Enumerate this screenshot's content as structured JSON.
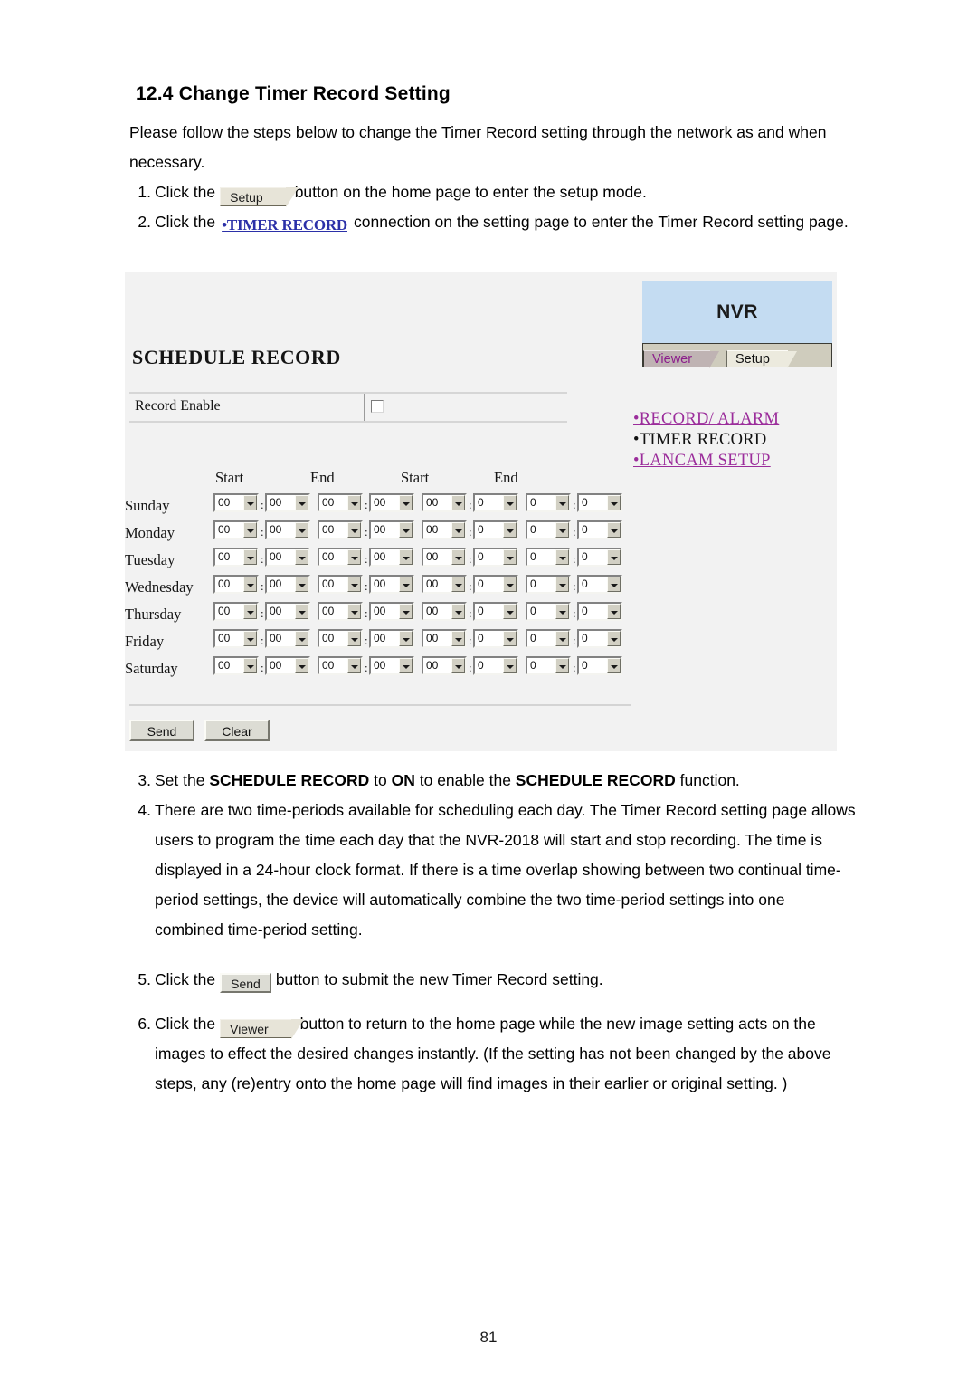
{
  "document": {
    "heading": "12.4 Change Timer Record Setting",
    "intro": "Please follow the steps below to change the Timer Record setting through the network as and when necessary.",
    "page_number": "81"
  },
  "steps_top": [
    {
      "num": "1.",
      "before": "Click the",
      "button": "Setup",
      "button_kind": "tab",
      "after": "button on the home page to enter the setup mode."
    },
    {
      "num": "2.",
      "before": "Click the",
      "link": "•TIMER RECORD",
      "after": "connection on the setting page to enter the Timer Record setting page."
    }
  ],
  "steps_bottom": [
    {
      "num": "3.",
      "segments": [
        {
          "text": "Set the ",
          "bold": false
        },
        {
          "text": "SCHEDULE RECORD",
          "bold": true
        },
        {
          "text": " to ",
          "bold": false
        },
        {
          "text": "ON",
          "bold": true
        },
        {
          "text": " to enable the ",
          "bold": false
        },
        {
          "text": "SCHEDULE RECORD",
          "bold": true
        },
        {
          "text": " function.",
          "bold": false
        }
      ]
    },
    {
      "num": "4.",
      "segments": [
        {
          "text": "There are two time-periods available for scheduling each day. The Timer Record setting page allows users to program the time each day that the NVR-2018 will start and stop recording. The time is displayed in a 24-hour clock format. If there is a time overlap showing between two continual time-period settings, the device will automatically combine the two time-period settings into one combined time-period setting.",
          "bold": false
        }
      ]
    },
    {
      "num": "5.",
      "before": "Click the",
      "button": "Send",
      "button_kind": "push",
      "after": "button to submit the new Timer Record setting."
    },
    {
      "num": "6.",
      "before": "Click the",
      "button": "Viewer",
      "button_kind": "tab",
      "after": "button to return to the home page while the new image setting acts on the       images to effect the desired changes instantly. (If the setting has not been changed by the above steps, any (re)entry onto the home page will find images in their earlier or original setting. )"
    }
  ],
  "screenshot": {
    "title": "SCHEDULE RECORD",
    "record_enable": {
      "label": "Record Enable",
      "checked": false
    },
    "schedule": {
      "column_headers": [
        "Start",
        "End",
        "Start",
        "End"
      ],
      "days": [
        {
          "name": "Sunday",
          "values": [
            "00",
            "00",
            "00",
            "00",
            "00",
            "0",
            "0",
            "0"
          ]
        },
        {
          "name": "Monday",
          "values": [
            "00",
            "00",
            "00",
            "00",
            "00",
            "0",
            "0",
            "0"
          ]
        },
        {
          "name": "Tuesday",
          "values": [
            "00",
            "00",
            "00",
            "00",
            "00",
            "0",
            "0",
            "0"
          ]
        },
        {
          "name": "Wednesday",
          "values": [
            "00",
            "00",
            "00",
            "00",
            "00",
            "0",
            "0",
            "0"
          ]
        },
        {
          "name": "Thursday",
          "values": [
            "00",
            "00",
            "00",
            "00",
            "00",
            "0",
            "0",
            "0"
          ]
        },
        {
          "name": "Friday",
          "values": [
            "00",
            "00",
            "00",
            "00",
            "00",
            "0",
            "0",
            "0"
          ]
        },
        {
          "name": "Saturday",
          "values": [
            "00",
            "00",
            "00",
            "00",
            "00",
            "0",
            "0",
            "0"
          ]
        }
      ],
      "separator": ":"
    },
    "buttons": {
      "send": "Send",
      "clear": "Clear"
    },
    "panel": {
      "brand": "NVR",
      "tabs": [
        {
          "label": "Viewer",
          "active": true
        },
        {
          "label": "Setup",
          "active": false
        }
      ],
      "nav": [
        {
          "label": "•RECORD/ ALARM",
          "link": true
        },
        {
          "label": "•TIMER RECORD",
          "link": false
        },
        {
          "label": "•LANCAM SETUP",
          "link": true
        }
      ]
    },
    "colors": {
      "brand_bg": "#c4dcf2",
      "page_bg": "#f2f2f2",
      "tab_active_bg": "#bfb3b3",
      "tab_active_fg": "#8c1e8c",
      "tab_inactive_bg": "#eceade",
      "nav_link": "#9b2d9b",
      "doc_link": "#2b30a8"
    }
  }
}
